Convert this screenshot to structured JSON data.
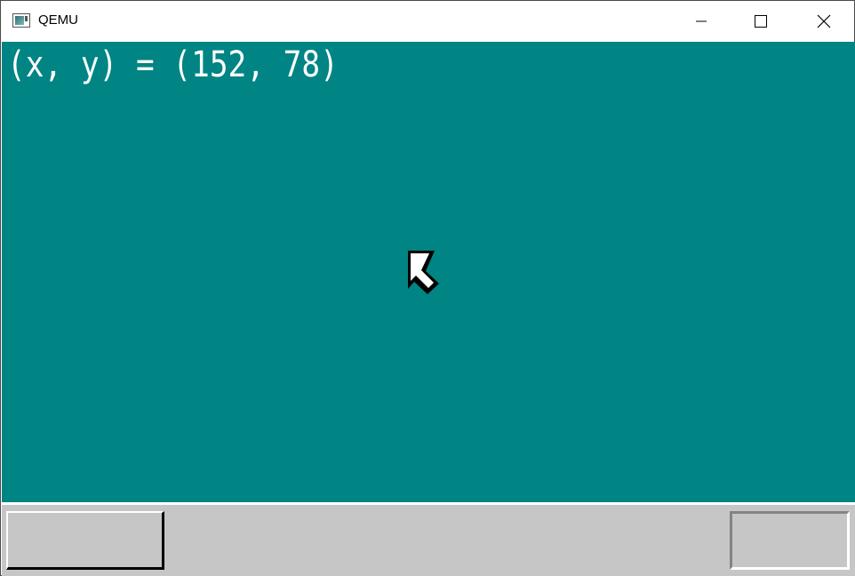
{
  "window": {
    "title": "QEMU",
    "controls": {
      "minimize_icon": "minimize-icon",
      "maximize_icon": "maximize-icon",
      "close_icon": "close-icon"
    }
  },
  "screen": {
    "background_color": "#008484",
    "coordinate_text": "(x, y) = (152, 78)",
    "cursor_icon": "arrow-cursor-icon"
  },
  "taskbar": {
    "background_color": "#c6c6c6"
  }
}
